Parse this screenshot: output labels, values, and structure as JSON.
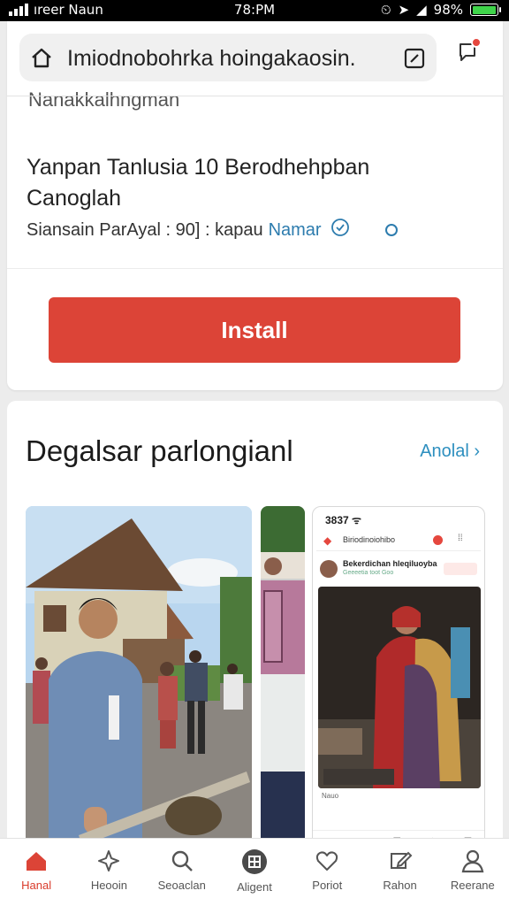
{
  "status_bar": {
    "carrier": "ıreer Naun",
    "time": "78:PM",
    "battery": "98%",
    "battery_level": 0.98
  },
  "url_bar": {
    "text": "Imiodnobohrka hoingakaosin."
  },
  "app": {
    "name_partial": "Nanakkalhngman",
    "title": "Yanpan Tanlusia 10 Berodhehpban Canoglah",
    "meta": "Siansain ParAyal : 90] : kapau",
    "meta_link": "Namar",
    "install_label": "Install"
  },
  "section": {
    "title": "Degalsar parlongianl",
    "see_all": "Anolal ›"
  },
  "screenshot_preview": {
    "time": "3837 ᯤ",
    "url": "Biriodinoiohibo",
    "post_name": "Bekerdichan hleqiluoyba",
    "post_sub": "Geeeetia toot Goo",
    "footer": "Nauo"
  },
  "bottom_nav": [
    {
      "label": "Hanal",
      "icon": "home-icon",
      "active": true
    },
    {
      "label": "Heooin",
      "icon": "sparkle-icon",
      "active": false
    },
    {
      "label": "Seoaclan",
      "icon": "search-icon",
      "active": false
    },
    {
      "label": "Aligent",
      "icon": "apps-icon",
      "active": false
    },
    {
      "label": "Poriot",
      "icon": "heart-icon",
      "active": false
    },
    {
      "label": "Rahon",
      "icon": "edit-icon",
      "active": false
    },
    {
      "label": "Reerane",
      "icon": "person-icon",
      "active": false
    }
  ],
  "colors": {
    "accent_red": "#dc4437",
    "link_blue": "#2d8fbf",
    "battery_green": "#3fd44a"
  }
}
